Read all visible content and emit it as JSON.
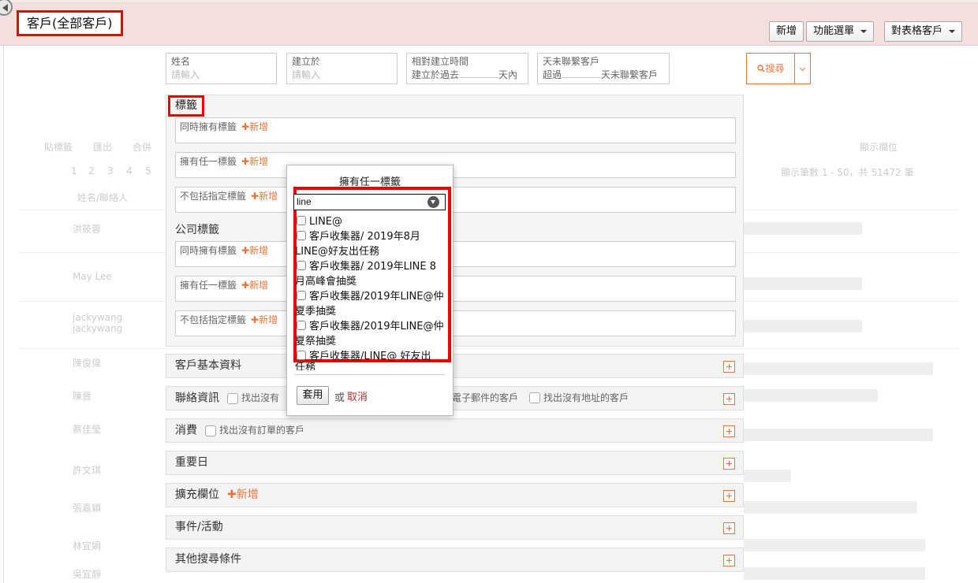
{
  "header": {
    "title": "客戶(全部客戶)",
    "buttons": {
      "add": "新增",
      "function_menu": "功能選單",
      "batch_customer": "對表格客戶"
    }
  },
  "filters": {
    "name": {
      "label": "姓名",
      "placeholder": "請輸入"
    },
    "created_at": {
      "label": "建立於",
      "placeholder": "請輸入"
    },
    "relative_created": {
      "label": "相對建立時間",
      "prefix": "建立於過去",
      "suffix": "天內"
    },
    "not_contacted": {
      "label": "天未聯繫客戶",
      "prefix": "超過",
      "suffix": "天未聯繫客戶"
    },
    "search_label": "搜尋"
  },
  "tags": {
    "title": "標籤",
    "has_all": "同時擁有標籤",
    "has_any": "擁有任一標籤",
    "exclude": "不包括指定標籤",
    "add": "新增",
    "company_title": "公司標籤"
  },
  "sections": {
    "basic_info": "客戶基本資料",
    "contact": "聯絡資訊",
    "contact_no_phone": "找出沒有",
    "contact_no_email": "電子郵件的客戶",
    "contact_no_address": "找出沒有地址的客戶",
    "consumption": "消費",
    "consumption_no_order": "找出沒有訂單的客戶",
    "important_days": "重要日",
    "extended_fields": "擴充欄位",
    "extended_add": "新增",
    "events": "事件/活動",
    "other_criteria": "其他搜尋條件"
  },
  "popup": {
    "title": "擁有任一標籤",
    "input_value": "line",
    "options": [
      "LINE@",
      "客戶收集器/ 2019年8月LINE@好友出任務",
      "客戶收集器/ 2019年LINE 8月高峰會抽獎",
      "客戶收集器/2019年LINE@仲夏季抽獎",
      "客戶收集器/2019年LINE@仲夏祭抽獎",
      "客戶收集器/LINE@ 好友出"
    ],
    "overflow_text": "任務",
    "apply": "套用",
    "or": "或",
    "cancel": "取消"
  },
  "background": {
    "toolbar": [
      "貼標籤",
      "匯出",
      "合併"
    ],
    "display_fields": "顯示欄位",
    "pages": [
      "1",
      "2",
      "3",
      "4",
      "5"
    ],
    "summary": "顯示筆數 1 - 50，共 51472 筆",
    "col_name": "姓名/聯絡人",
    "rows": [
      "洪筱蓉",
      "May Lee",
      "jackywang jackywang",
      "陳俊偉",
      "陳晉",
      "蔡佳瑩",
      "許文琪",
      "張嘉穎",
      "林宜娟",
      "吳宜靜"
    ]
  }
}
